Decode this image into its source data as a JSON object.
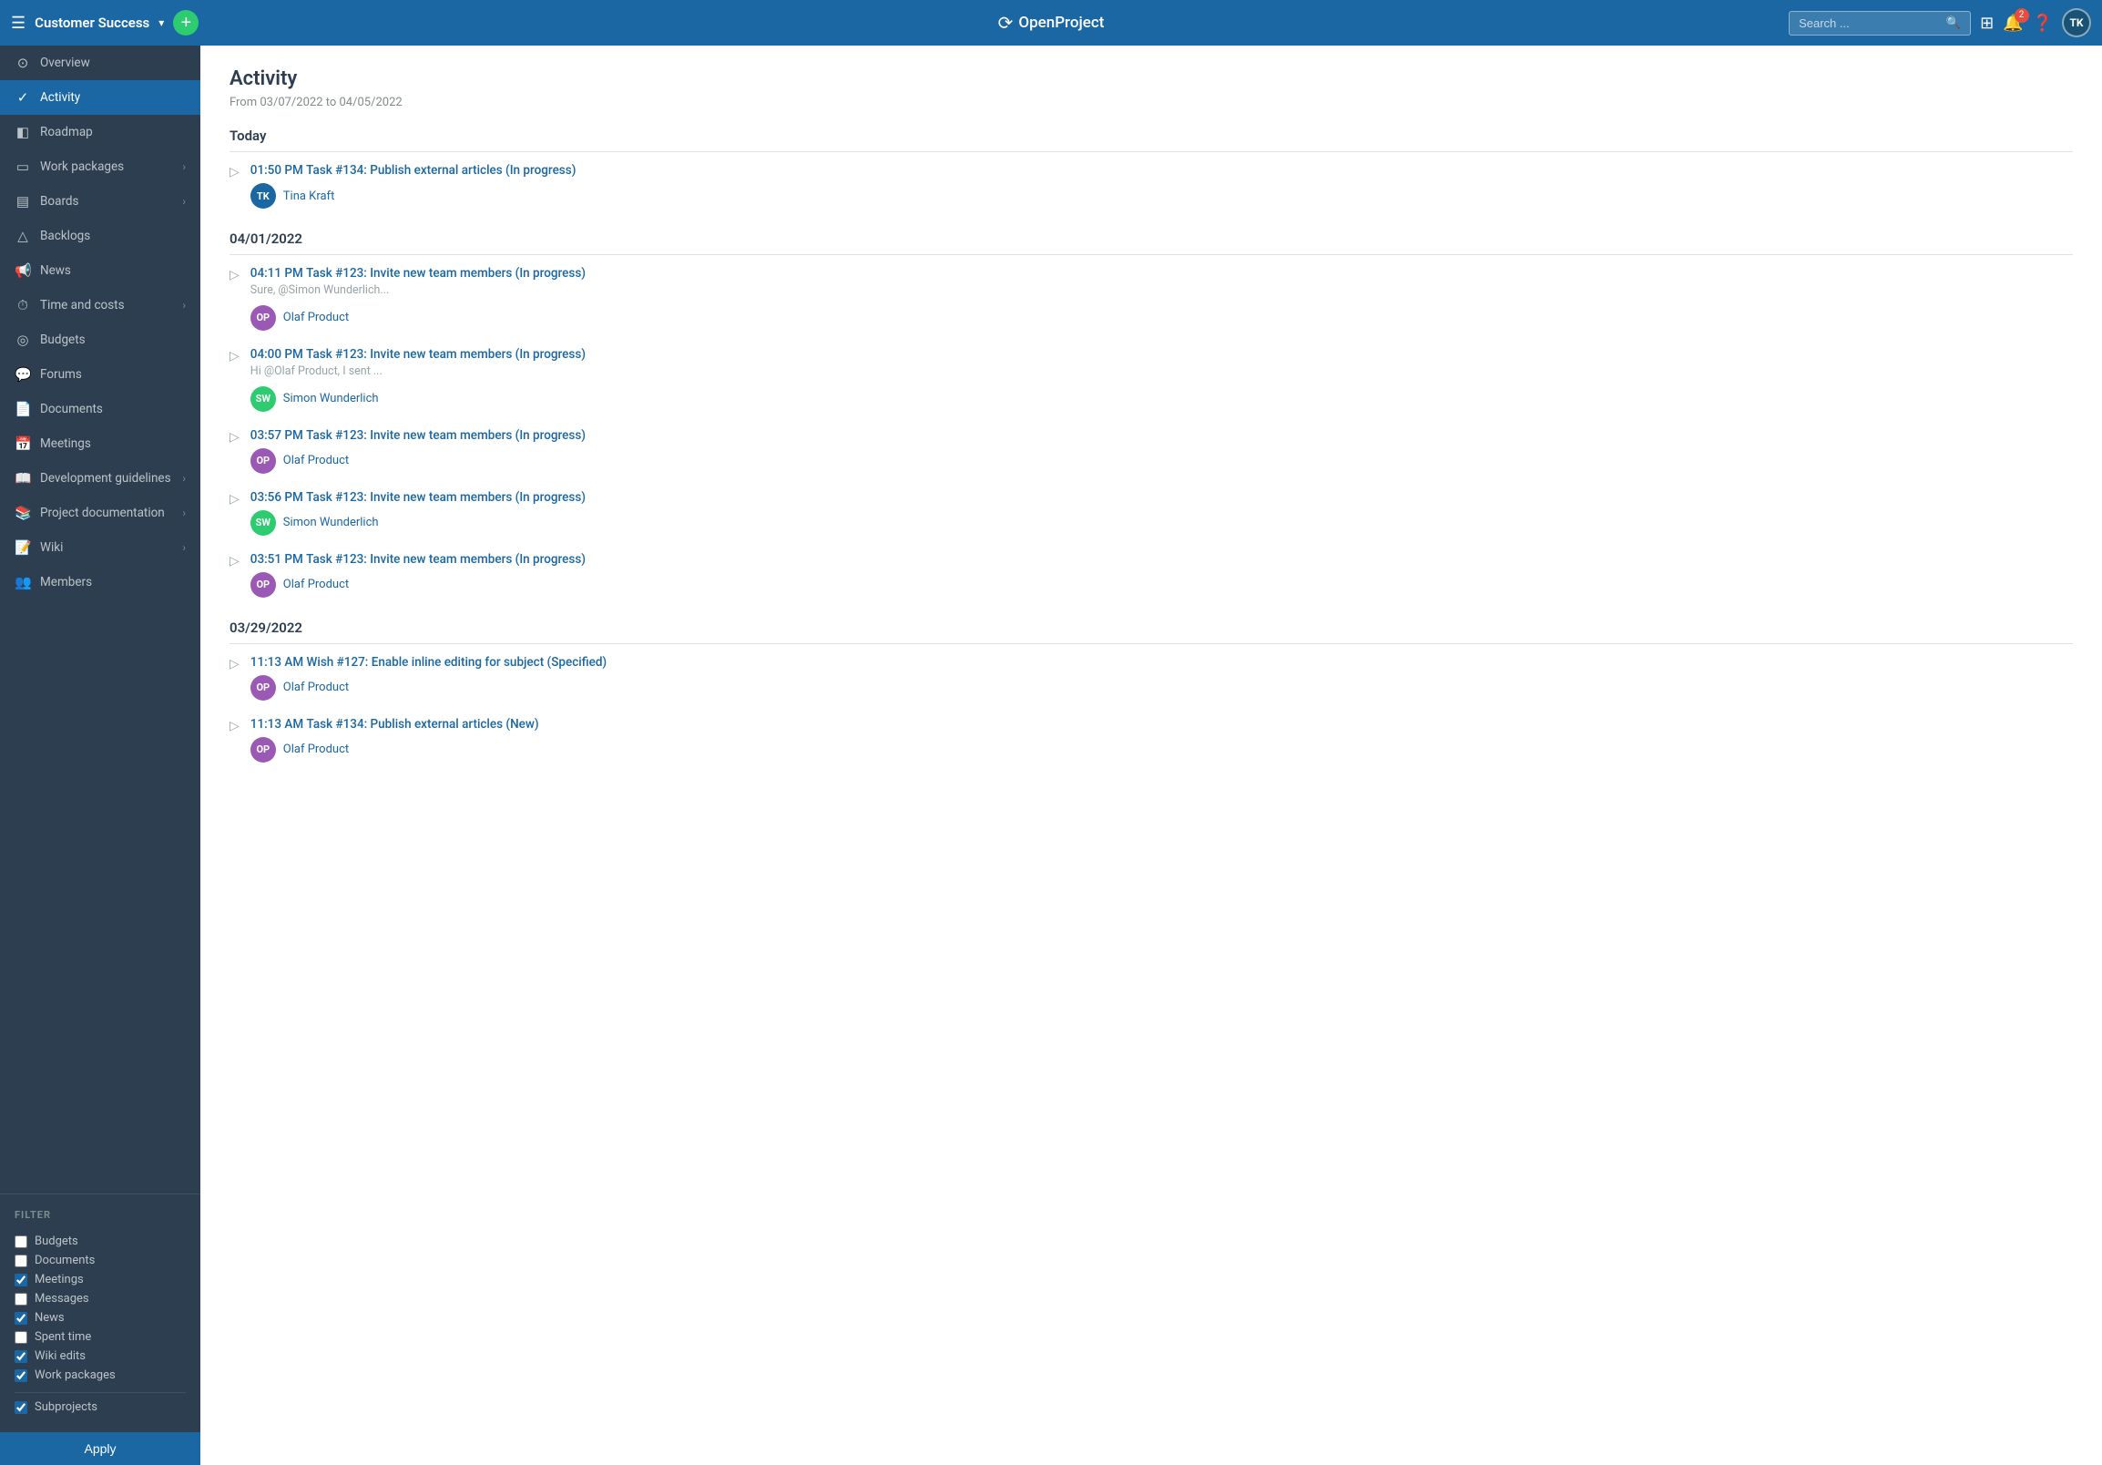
{
  "topNav": {
    "projectName": "Customer Success",
    "logoText": "OpenProject",
    "searchPlaceholder": "Search ...",
    "userInitials": "TK",
    "notificationCount": "2"
  },
  "sidebar": {
    "items": [
      {
        "id": "overview",
        "label": "Overview",
        "icon": "○",
        "arrow": false,
        "active": false
      },
      {
        "id": "activity",
        "label": "Activity",
        "icon": "✓",
        "arrow": false,
        "active": true
      },
      {
        "id": "roadmap",
        "label": "Roadmap",
        "icon": "▦",
        "arrow": false,
        "active": false
      },
      {
        "id": "work-packages",
        "label": "Work packages",
        "icon": "▭",
        "arrow": true,
        "active": false
      },
      {
        "id": "boards",
        "label": "Boards",
        "icon": "▤",
        "arrow": true,
        "active": false
      },
      {
        "id": "backlogs",
        "label": "Backlogs",
        "icon": "△",
        "arrow": false,
        "active": false
      },
      {
        "id": "news",
        "label": "News",
        "icon": "📢",
        "arrow": false,
        "active": false
      },
      {
        "id": "time-and-costs",
        "label": "Time and costs",
        "icon": "⏱",
        "arrow": true,
        "active": false
      },
      {
        "id": "budgets",
        "label": "Budgets",
        "icon": "💰",
        "arrow": false,
        "active": false
      },
      {
        "id": "forums",
        "label": "Forums",
        "icon": "💬",
        "arrow": false,
        "active": false
      },
      {
        "id": "documents",
        "label": "Documents",
        "icon": "📄",
        "arrow": false,
        "active": false
      },
      {
        "id": "meetings",
        "label": "Meetings",
        "icon": "📅",
        "arrow": false,
        "active": false
      },
      {
        "id": "development-guidelines",
        "label": "Development guidelines",
        "icon": "📖",
        "arrow": true,
        "active": false
      },
      {
        "id": "project-documentation",
        "label": "Project documentation",
        "icon": "📚",
        "arrow": true,
        "active": false
      },
      {
        "id": "wiki",
        "label": "Wiki",
        "icon": "📝",
        "arrow": true,
        "active": false
      },
      {
        "id": "members",
        "label": "Members",
        "icon": "👥",
        "arrow": false,
        "active": false
      }
    ],
    "filterTitle": "FILTER",
    "filterItems": [
      {
        "id": "budgets",
        "label": "Budgets",
        "checked": false
      },
      {
        "id": "documents",
        "label": "Documents",
        "checked": false
      },
      {
        "id": "meetings",
        "label": "Meetings",
        "checked": true
      },
      {
        "id": "messages",
        "label": "Messages",
        "checked": false
      },
      {
        "id": "news",
        "label": "News",
        "checked": true
      },
      {
        "id": "spent-time",
        "label": "Spent time",
        "checked": false
      },
      {
        "id": "wiki-edits",
        "label": "Wiki edits",
        "checked": true
      },
      {
        "id": "work-packages",
        "label": "Work packages",
        "checked": true
      }
    ],
    "subprojectsLabel": "Subprojects",
    "subprojectsChecked": true,
    "applyLabel": "Apply"
  },
  "main": {
    "title": "Activity",
    "dateRange": "From 03/07/2022 to 04/05/2022",
    "sections": [
      {
        "id": "today",
        "dayLabel": "Today",
        "items": [
          {
            "id": "item1",
            "time": "01:50 PM",
            "linkText": "Task #134: Publish external articles (In progress)",
            "preview": null,
            "user": {
              "initials": "TK",
              "name": "Tina Kraft",
              "avatarClass": "avatar-tk"
            }
          }
        ]
      },
      {
        "id": "apr-01",
        "dayLabel": "04/01/2022",
        "items": [
          {
            "id": "item2",
            "time": "04:11 PM",
            "linkText": "Task #123: Invite new team members (In progress)",
            "preview": "Sure, <mention class=\"mention\" data-id=\"5\" data-type=\"user\" data-text=\"@Simon Wunderlich\">@Simon Wunderlich</mention>...",
            "user": {
              "initials": "OP",
              "name": "Olaf Product",
              "avatarClass": "avatar-op"
            }
          },
          {
            "id": "item3",
            "time": "04:00 PM",
            "linkText": "Task #123: Invite new team members (In progress)",
            "preview": "Hi <mention class=\"mention\" data-id=\"1\" data-type=\"user\" data-text=\"@Olaf Product\">@Olaf Product</mention>,\nI sent ...",
            "user": {
              "initials": "SW",
              "name": "Simon Wunderlich",
              "avatarClass": "avatar-sw"
            }
          },
          {
            "id": "item4",
            "time": "03:57 PM",
            "linkText": "Task #123: Invite new team members (In progress)",
            "preview": null,
            "user": {
              "initials": "OP",
              "name": "Olaf Product",
              "avatarClass": "avatar-op"
            }
          },
          {
            "id": "item5",
            "time": "03:56 PM",
            "linkText": "Task #123: Invite new team members (In progress)",
            "preview": null,
            "user": {
              "initials": "SW",
              "name": "Simon Wunderlich",
              "avatarClass": "avatar-sw"
            }
          },
          {
            "id": "item6",
            "time": "03:51 PM",
            "linkText": "Task #123: Invite new team members (In progress)",
            "preview": null,
            "user": {
              "initials": "OP",
              "name": "Olaf Product",
              "avatarClass": "avatar-op"
            }
          }
        ]
      },
      {
        "id": "mar-29",
        "dayLabel": "03/29/2022",
        "items": [
          {
            "id": "item7",
            "time": "11:13 AM",
            "linkText": "Wish #127: Enable inline editing for subject (Specified)",
            "preview": null,
            "user": {
              "initials": "OP",
              "name": "Olaf Product",
              "avatarClass": "avatar-op"
            }
          },
          {
            "id": "item8",
            "time": "11:13 AM",
            "linkText": "Task #134: Publish external articles (New)",
            "preview": null,
            "user": {
              "initials": "OP",
              "name": "Olaf Product",
              "avatarClass": "avatar-op"
            }
          }
        ]
      }
    ]
  }
}
